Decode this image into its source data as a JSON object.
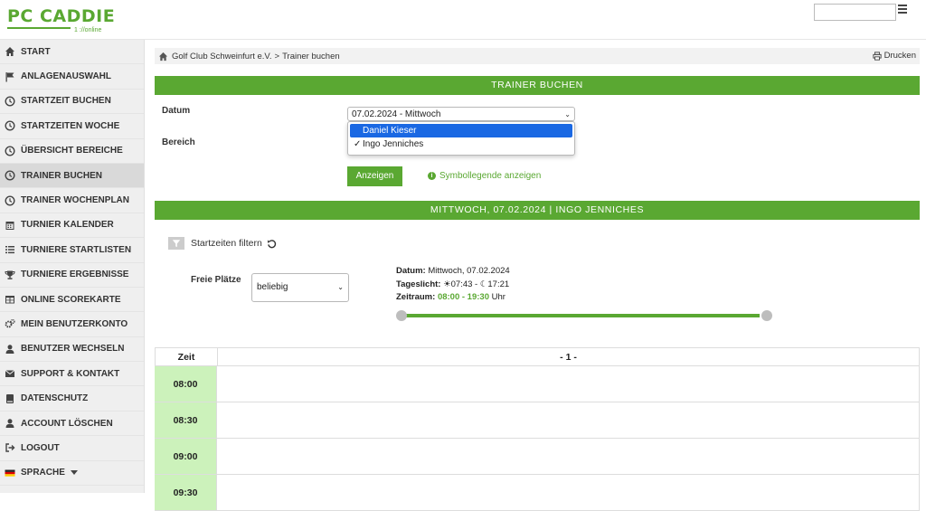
{
  "header": {
    "logo_text": "PC CADDIE",
    "logo_sub": "1 ://online",
    "search_value": ""
  },
  "sidebar": {
    "items": [
      {
        "label": "START",
        "icon": "home-icon"
      },
      {
        "label": "ANLAGENAUSWAHL",
        "icon": "flag-icon"
      },
      {
        "label": "STARTZEIT BUCHEN",
        "icon": "clock-icon"
      },
      {
        "label": "STARTZEITEN WOCHE",
        "icon": "clock-icon"
      },
      {
        "label": "ÜBERSICHT BEREICHE",
        "icon": "clock-icon"
      },
      {
        "label": "TRAINER BUCHEN",
        "icon": "clock-icon",
        "active": true
      },
      {
        "label": "TRAINER WOCHENPLAN",
        "icon": "clock-icon"
      },
      {
        "label": "TURNIER KALENDER",
        "icon": "calendar-icon"
      },
      {
        "label": "TURNIERE STARTLISTEN",
        "icon": "list-icon"
      },
      {
        "label": "TURNIERE ERGEBNISSE",
        "icon": "trophy-icon"
      },
      {
        "label": "ONLINE SCOREKARTE",
        "icon": "table-icon"
      },
      {
        "label": "MEIN BENUTZERKONTO",
        "icon": "cogs-icon"
      },
      {
        "label": "BENUTZER WECHSELN",
        "icon": "user-icon"
      },
      {
        "label": "SUPPORT & KONTAKT",
        "icon": "envelope-icon"
      },
      {
        "label": "DATENSCHUTZ",
        "icon": "book-icon"
      },
      {
        "label": "ACCOUNT LÖSCHEN",
        "icon": "user-icon"
      },
      {
        "label": "LOGOUT",
        "icon": "logout-icon"
      },
      {
        "label": "SPRACHE",
        "icon": "german-flag-icon"
      }
    ]
  },
  "breadcrumb": {
    "club": "Golf Club Schweinfurt e.V.",
    "separator": ">",
    "page": "Trainer buchen",
    "print_label": "Drucken"
  },
  "booking": {
    "header": "TRAINER BUCHEN",
    "datum_label": "Datum",
    "bereich_label": "Bereich",
    "datum_value": "07.02.2024 - Mittwoch",
    "bereich_options": [
      {
        "label": "Daniel Kieser",
        "highlighted": true,
        "checked": false
      },
      {
        "label": "Ingo Jenniches",
        "highlighted": false,
        "checked": true
      }
    ],
    "show_button": "Anzeigen",
    "legend_link": "Symbollegende anzeigen"
  },
  "schedule": {
    "header": "MITTWOCH, 07.02.2024 | INGO JENNICHES",
    "filter_label": "Startzeiten filtern",
    "freie_label": "Freie Plätze",
    "freie_value": "beliebig",
    "datum_label": "Datum:",
    "datum_value": "Mittwoch, 07.02.2024",
    "daylight_label": "Tageslicht:",
    "sunrise": "07:43",
    "daylight_sep": "-",
    "sunset": "17:21",
    "range_label": "Zeitraum:",
    "range_value": "08:00 - 19:30",
    "range_unit": "Uhr",
    "slider_range": [
      0,
      1
    ]
  },
  "table": {
    "col_zeit": "Zeit",
    "col_main": "- 1 -",
    "rows": [
      "08:00",
      "08:30",
      "09:00",
      "09:30"
    ]
  },
  "colors": {
    "accent": "#5aa832",
    "time_cell": "#ccf2bb",
    "highlight": "#1a68e3"
  }
}
